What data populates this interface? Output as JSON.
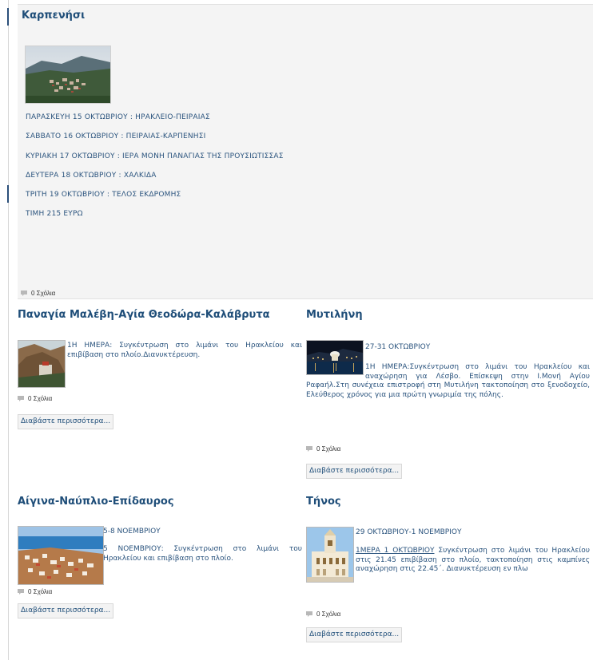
{
  "featured": {
    "title": "Καρπενήσι",
    "lines": [
      "ΠΑΡΑΣΚΕΥΗ 15 ΟΚΤΩΒΡΙΟΥ : ΗΡΑΚΛΕΙΟ-ΠΕΙΡΑΙΑΣ",
      "ΣΑΒΒΑΤΟ 16 ΟΚΤΩΒΡΙΟΥ : ΠΕΙΡΑΙΑΣ-ΚΑΡΠΕΝΗΣΙ",
      "ΚΥΡΙΑΚΗ 17 ΟΚΤΩΒΡΙΟΥ : ΙΕΡΑ ΜΟΝΗ ΠΑΝΑΓΙΑΣ ΤΗΣ ΠΡΟΥΣΙΩΤΙΣΣΑΣ",
      "ΔΕΥΤΕΡΑ 18 ΟΚΤΩΒΡΙΟΥ : ΧΑΛΚΙΔΑ",
      "ΤΡΙΤΗ 19 ΟΚΤΩΒΡΙΟΥ : ΤΕΛΟΣ ΕΚΔΡΟΜΗΣ",
      "ΤΙΜΗ 215 ΕΥΡΩ"
    ],
    "comments": "0 Σχόλια"
  },
  "articles": [
    {
      "title": "Παναγία Μαλέβη-Αγία Θεοδώρα-Καλάβρυτα",
      "date": "",
      "desc": "1Η ΗΜΕΡΑ: Συγκέντρωση στο λιμάνι του Ηρακλείου και επιβίβαση στο πλοίο.Διανυκτέρευση.",
      "comments": "0 Σχόλια",
      "read_more": "Διαβάστε περισσότερα..."
    },
    {
      "title": "Μυτιλήνη",
      "date": "27-31 ΟΚΤΩΒΡΙΟΥ",
      "desc": "1Η ΗΜΕΡΑ:Συγκέντρωση στο λιμάνι του Ηρακλείου και αναχώρηση για Λέσβο. Επίσκεψη στην Ι.Μονή Αγίου Ραφαήλ.Στη συνέχεια επιστροφή στη Μυτιλήνη τακτοποίηση στο ξενοδοχείο, Ελεύθερος χρόνος για μια πρώτη γνωριμία της πόλης.",
      "comments": "0 Σχόλια",
      "read_more": "Διαβάστε περισσότερα..."
    },
    {
      "title": "Αίγινα-Ναύπλιο-Επίδαυρος",
      "date": "5-8 ΝΟΕΜΒΡΙΟΥ",
      "desc": "5 ΝΟΕΜΒΡΙΟΥ: Συγκέντρωση στο λιμάνι του Ηρακλείου και επιβίβαση στο πλοίο.",
      "comments": "0 Σχόλια",
      "read_more": "Διαβάστε περισσότερα..."
    },
    {
      "title": "Τήνος",
      "date": "29 ΟΚΤΩΒΡΙΟΥ-1 ΝΟΕΜΒΡΙΟΥ",
      "desc_link": "1ΜΕΡΑ 1 ΟΚΤΩΒΡΙΟΥ",
      "desc": " Συγκέντρωση στο λιμάνι του Ηρακλείου στις 21.45 επιβίβαση στο πλοίο, τακτοποίηση στις καμπίνες αναχώρηση στις 22.45΄. Διανυκτέρευση εν πλω",
      "comments": "0 Σχόλια",
      "read_more": "Διαβάστε περισσότερα..."
    }
  ]
}
